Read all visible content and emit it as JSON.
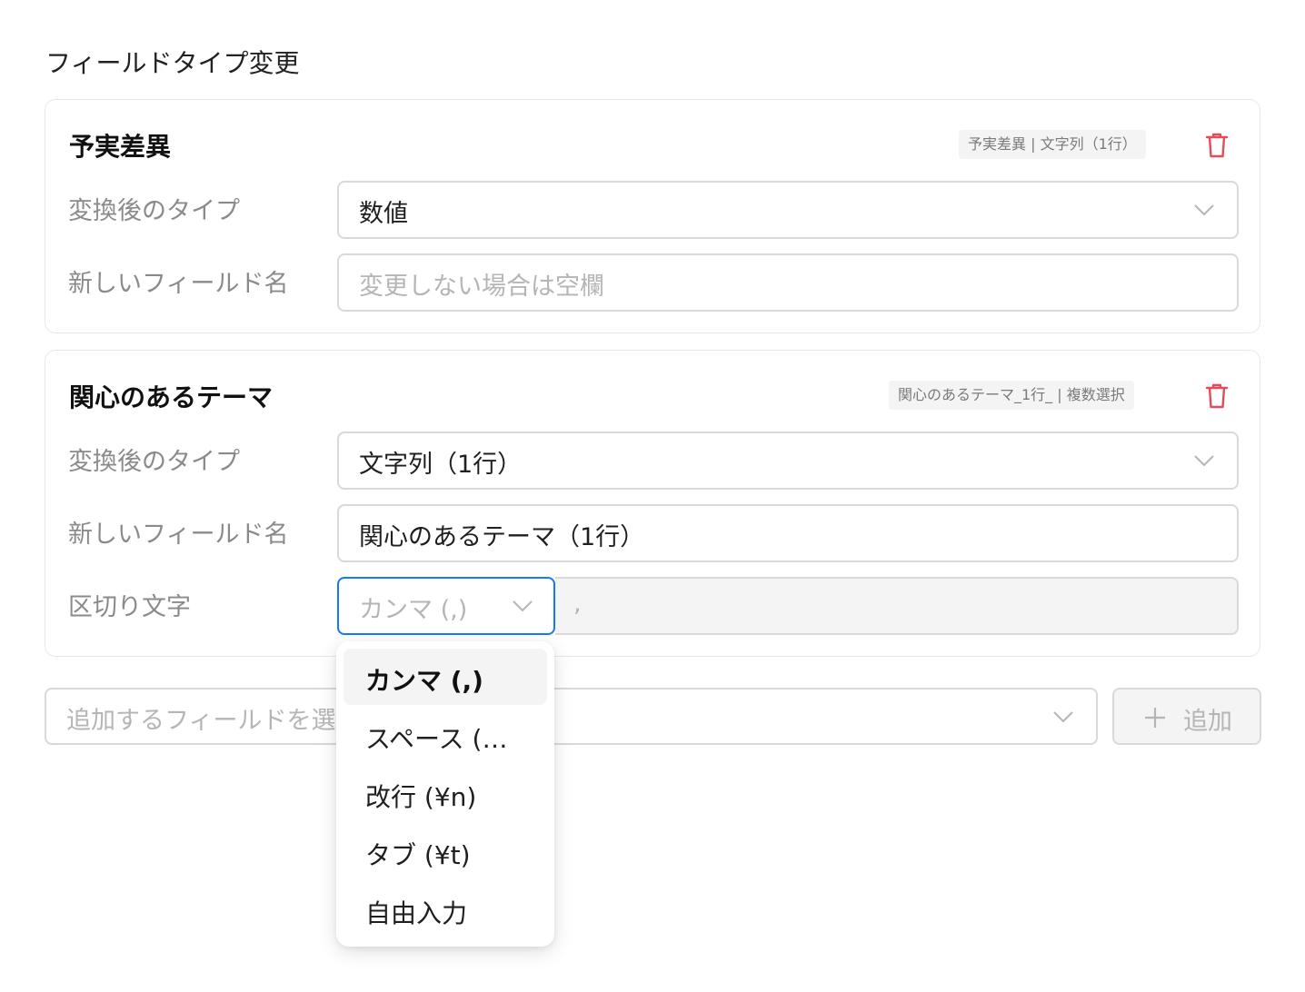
{
  "page": {
    "section_title": "フィールドタイプ変更"
  },
  "cards": [
    {
      "title": "予実差異",
      "tag": "予実差異 | 文字列（1行）",
      "type_label": "変換後のタイプ",
      "type_value": "数値",
      "name_label": "新しいフィールド名",
      "name_value": "",
      "name_placeholder": "変更しない場合は空欄"
    },
    {
      "title": "関心のあるテーマ",
      "tag": "関心のあるテーマ_1行_ | 複数選択",
      "type_label": "変換後のタイプ",
      "type_value": "文字列（1行）",
      "name_label": "新しいフィールド名",
      "name_value": "関心のあるテーマ（1行）",
      "separator_label": "区切り文字",
      "separator_select_value": "カンマ (,)",
      "separator_input_value": ","
    }
  ],
  "add_field": {
    "placeholder": "追加するフィールドを選択",
    "button_label": "追加"
  },
  "dropdown": {
    "options": [
      {
        "label": "カンマ (,)",
        "selected": true
      },
      {
        "label": "スペース (…",
        "selected": false
      },
      {
        "label": "改行 (¥n)",
        "selected": false
      },
      {
        "label": "タブ (¥t)",
        "selected": false
      },
      {
        "label": "自由入力",
        "selected": false
      }
    ]
  },
  "colors": {
    "delete_icon": "#e34d59",
    "focus_border": "#1677ff",
    "label_text": "#8a8a8a",
    "placeholder_text": "#b5b5b5"
  },
  "icons": {
    "delete": "trash-icon",
    "select_arrow": "chevron-down-icon",
    "add": "plus-icon"
  }
}
